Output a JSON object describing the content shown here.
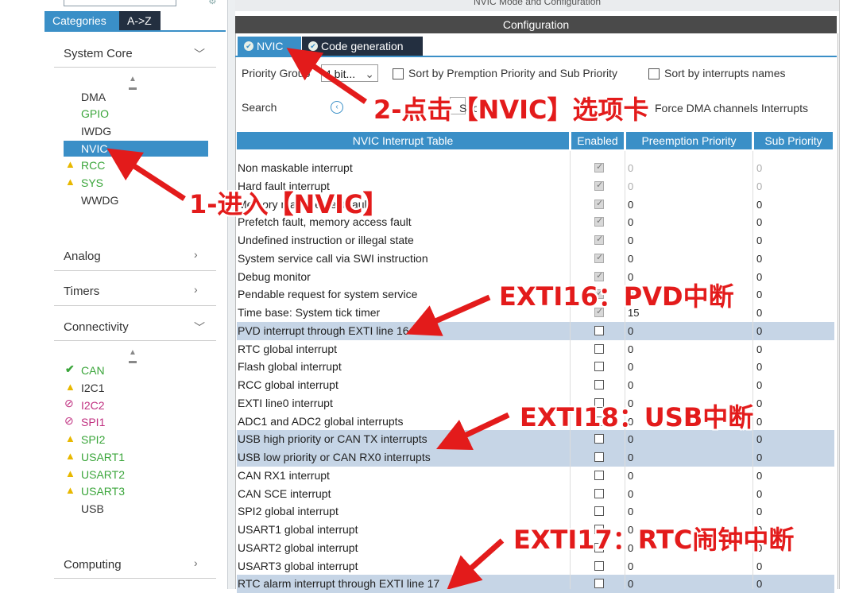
{
  "sidebar": {
    "tab_categories": "Categories",
    "tab_az": "A->Z",
    "groups": {
      "system_core": "System Core",
      "analog": "Analog",
      "timers": "Timers",
      "connectivity": "Connectivity",
      "computing": "Computing"
    },
    "system_core_items": [
      "DMA",
      "GPIO",
      "IWDG",
      "NVIC",
      "RCC",
      "SYS",
      "WWDG"
    ],
    "connectivity_items": [
      "CAN",
      "I2C1",
      "I2C2",
      "SPI1",
      "SPI2",
      "USART1",
      "USART2",
      "USART3",
      "USB"
    ]
  },
  "main": {
    "title": "NVIC Mode and Configuration",
    "config_title": "Configuration",
    "tabs": [
      "NVIC",
      "Code generation"
    ],
    "priority_group_label": "Priority Group",
    "priority_group_value": "4 bit...",
    "sort_premption": "Sort by Premption Priority and Sub Priority",
    "sort_names": "Sort by interrupts names",
    "search_label": "Search",
    "show_only_enabled": "Show only enabled interrupts",
    "force_dma": "Force DMA channels Interrupts",
    "table_headers": [
      "NVIC Interrupt Table",
      "Enabled",
      "Preemption Priority",
      "Sub Priority"
    ],
    "rows": [
      {
        "name": "Non maskable interrupt",
        "enabled": true,
        "fixed": true,
        "pp": "0",
        "sp": "0",
        "hl": false
      },
      {
        "name": "Hard fault interrupt",
        "enabled": true,
        "fixed": true,
        "pp": "0",
        "sp": "0",
        "hl": false
      },
      {
        "name": "Memory management fault",
        "enabled": true,
        "fixed": true,
        "pp": "0",
        "sp": "0",
        "hl": false
      },
      {
        "name": "Prefetch fault, memory access fault",
        "enabled": true,
        "fixed": true,
        "pp": "0",
        "sp": "0",
        "hl": false
      },
      {
        "name": "Undefined instruction or illegal state",
        "enabled": true,
        "fixed": true,
        "pp": "0",
        "sp": "0",
        "hl": false
      },
      {
        "name": "System service call via SWI instruction",
        "enabled": true,
        "fixed": true,
        "pp": "0",
        "sp": "0",
        "hl": false
      },
      {
        "name": "Debug monitor",
        "enabled": true,
        "fixed": true,
        "pp": "0",
        "sp": "0",
        "hl": false
      },
      {
        "name": "Pendable request for system service",
        "enabled": true,
        "fixed": true,
        "pp": "0",
        "sp": "0",
        "hl": false
      },
      {
        "name": "Time base: System tick timer",
        "enabled": true,
        "fixed": true,
        "pp": "15",
        "sp": "0",
        "hl": false
      },
      {
        "name": "PVD interrupt through EXTI line 16",
        "enabled": false,
        "fixed": false,
        "pp": "0",
        "sp": "0",
        "hl": true
      },
      {
        "name": "RTC global interrupt",
        "enabled": false,
        "fixed": false,
        "pp": "0",
        "sp": "0",
        "hl": false
      },
      {
        "name": "Flash global interrupt",
        "enabled": false,
        "fixed": false,
        "pp": "0",
        "sp": "0",
        "hl": false
      },
      {
        "name": "RCC global interrupt",
        "enabled": false,
        "fixed": false,
        "pp": "0",
        "sp": "0",
        "hl": false
      },
      {
        "name": "EXTI line0 interrupt",
        "enabled": false,
        "fixed": false,
        "pp": "0",
        "sp": "0",
        "hl": false
      },
      {
        "name": "ADC1 and ADC2 global interrupts",
        "enabled": false,
        "fixed": false,
        "pp": "0",
        "sp": "0",
        "hl": false
      },
      {
        "name": "USB high priority or CAN TX interrupts",
        "enabled": false,
        "fixed": false,
        "pp": "0",
        "sp": "0",
        "hl": true
      },
      {
        "name": "USB low priority or CAN RX0 interrupts",
        "enabled": false,
        "fixed": false,
        "pp": "0",
        "sp": "0",
        "hl": true
      },
      {
        "name": "CAN RX1 interrupt",
        "enabled": false,
        "fixed": false,
        "pp": "0",
        "sp": "0",
        "hl": false
      },
      {
        "name": "CAN SCE interrupt",
        "enabled": false,
        "fixed": false,
        "pp": "0",
        "sp": "0",
        "hl": false
      },
      {
        "name": "SPI2 global interrupt",
        "enabled": false,
        "fixed": false,
        "pp": "0",
        "sp": "0",
        "hl": false
      },
      {
        "name": "USART1 global interrupt",
        "enabled": false,
        "fixed": false,
        "pp": "0",
        "sp": "0",
        "hl": false
      },
      {
        "name": "USART2 global interrupt",
        "enabled": false,
        "fixed": false,
        "pp": "0",
        "sp": "0",
        "hl": false
      },
      {
        "name": "USART3 global interrupt",
        "enabled": false,
        "fixed": false,
        "pp": "0",
        "sp": "0",
        "hl": false
      },
      {
        "name": "RTC alarm interrupt through EXTI line 17",
        "enabled": false,
        "fixed": false,
        "pp": "0",
        "sp": "0",
        "hl": true
      }
    ]
  },
  "annotations": {
    "step1": "1-进入【NVIC】",
    "step2": "2-点击【NVIC】选项卡",
    "exti16": "EXTI16：PVD中断",
    "exti18": "EXTI18：USB中断",
    "exti17": "EXTI17：RTC闹钟中断"
  },
  "colors": {
    "accent": "#3a8fc7",
    "annotation": "#e31b1b",
    "highlight_row": "#c6d5e6",
    "warn": "#e8b800",
    "ok": "#3aa53a",
    "error": "#c03080"
  }
}
